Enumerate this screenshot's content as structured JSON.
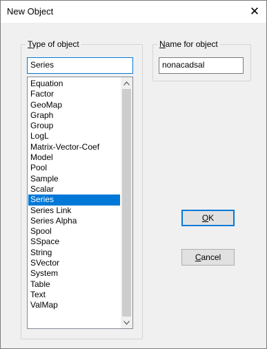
{
  "window": {
    "title": "New Object",
    "close_glyph": "✕"
  },
  "type_group": {
    "label_accel": "T",
    "label_rest": "ype of object",
    "input_value": "Series",
    "items": [
      "Equation",
      "Factor",
      "GeoMap",
      "Graph",
      "Group",
      "LogL",
      "Matrix-Vector-Coef",
      "Model",
      "Pool",
      "Sample",
      "Scalar",
      "Series",
      "Series Link",
      "Series Alpha",
      "Spool",
      "SSpace",
      "String",
      "SVector",
      "System",
      "Table",
      "Text",
      "ValMap"
    ],
    "selected": "Series"
  },
  "name_group": {
    "label_accel": "N",
    "label_rest": "ame for object",
    "input_value": "nonacadsal"
  },
  "buttons": {
    "ok_accel": "O",
    "ok_rest": "K",
    "cancel_accel": "C",
    "cancel_rest": "ancel"
  },
  "colors": {
    "selection": "#0078d7",
    "dialog_bg": "#f0f0f0"
  },
  "icons": {
    "close": "close-icon",
    "scroll_up": "chevron-up-icon",
    "scroll_down": "chevron-down-icon"
  }
}
